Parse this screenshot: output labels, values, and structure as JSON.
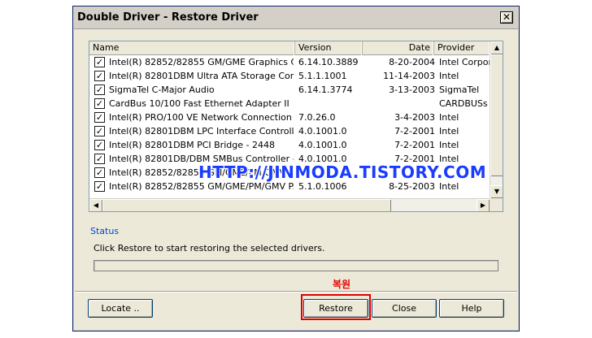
{
  "window": {
    "title": "Double Driver - Restore Driver",
    "close_glyph": "✕"
  },
  "list": {
    "columns": [
      "Name",
      "Version",
      "Date",
      "Provider"
    ],
    "rows": [
      {
        "checked": true,
        "name": "Intel(R) 82852/82855 GM/GME Graphics Con...",
        "version": "6.14.10.3889",
        "date": "8-20-2004",
        "provider": "Intel Corporat"
      },
      {
        "checked": true,
        "name": "Intel(R) 82801DBM Ultra ATA Storage Contr...",
        "version": "5.1.1.1001",
        "date": "11-14-2003",
        "provider": "Intel"
      },
      {
        "checked": true,
        "name": "SigmaTel C-Major Audio",
        "version": "6.14.1.3774",
        "date": "3-13-2003",
        "provider": "SigmaTel"
      },
      {
        "checked": true,
        "name": "CardBus 10/100 Fast Ethernet Adapter II",
        "version": "",
        "date": "",
        "provider": "CARDBUSs"
      },
      {
        "checked": true,
        "name": "Intel(R) PRO/100 VE Network Connection",
        "version": "7.0.26.0",
        "date": "3-4-2003",
        "provider": "Intel"
      },
      {
        "checked": true,
        "name": "Intel(R) 82801DBM LPC Interface Controller ...",
        "version": "4.0.1001.0",
        "date": "7-2-2001",
        "provider": "Intel"
      },
      {
        "checked": true,
        "name": "Intel(R) 82801DBM PCI Bridge - 2448",
        "version": "4.0.1001.0",
        "date": "7-2-2001",
        "provider": "Intel"
      },
      {
        "checked": true,
        "name": "Intel(R) 82801DB/DBM SMBus Controller - 2...",
        "version": "4.0.1001.0",
        "date": "7-2-2001",
        "provider": "Intel"
      },
      {
        "checked": true,
        "name": "Intel(R) 82852/82855 GM/GME/PM/GMV Pro...",
        "version": "",
        "date": "",
        "provider": ""
      },
      {
        "checked": true,
        "name": "Intel(R) 82852/82855 GM/GME/PM/GMV P...",
        "version": "5.1.0.1006",
        "date": "8-25-2003",
        "provider": "Intel"
      }
    ]
  },
  "status": {
    "label": "Status",
    "message": "Click Restore to start restoring the selected drivers."
  },
  "buttons": {
    "locate": "Locate ..",
    "restore": "Restore",
    "close": "Close",
    "help": "Help"
  },
  "annotation": {
    "korean_label": "복원",
    "color": "#e00000"
  },
  "watermark": "HTTP://JINMODA.TISTORY.COM",
  "colors": {
    "title_bg": "#d4d0c8",
    "dialog_bg": "#ece9d8",
    "status_label": "#0046d5",
    "watermark": "#1a3cff"
  }
}
